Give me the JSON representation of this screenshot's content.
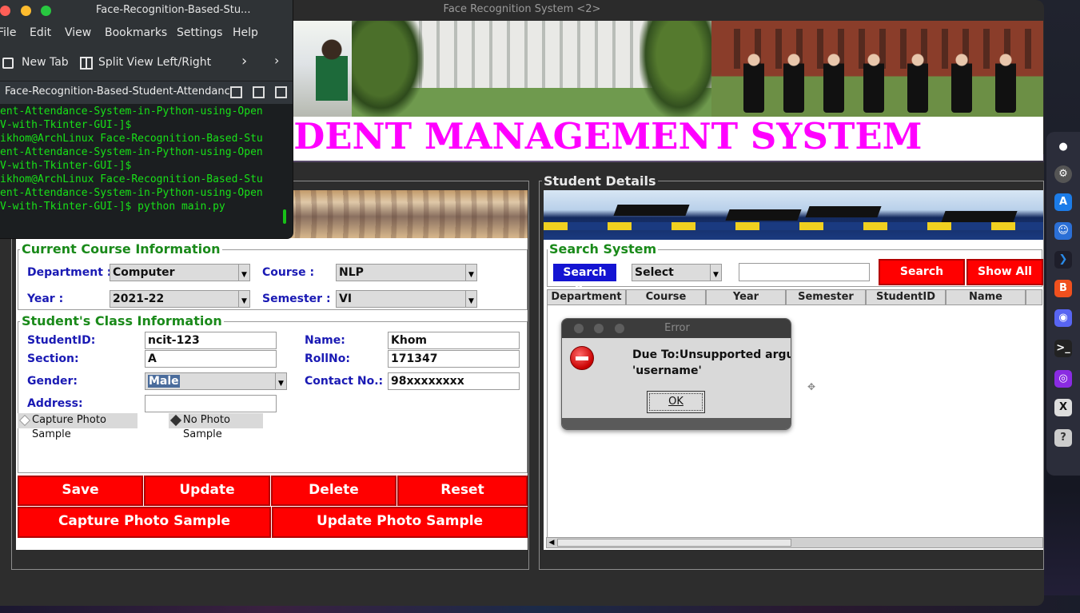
{
  "main_window": {
    "title": "Face Recognition System <2>",
    "app_title": "STUDENT MANAGEMENT SYSTEM"
  },
  "terminal": {
    "title": "Face-Recognition-Based-Stu...",
    "menu": [
      "File",
      "Edit",
      "View",
      "Bookmarks",
      "Settings",
      "Help"
    ],
    "toolbar": {
      "new_tab": "New Tab",
      "split_view": "Split View Left/Right"
    },
    "tab_label": "Face-Recognition-Based-Student-Attendance-",
    "lines": [
      "ent-Attendance-System-in-Python-using-Open",
      "V-with-Tkinter-GUI-]$",
      "ikhom@ArchLinux Face-Recognition-Based-Stu",
      "ent-Attendance-System-in-Python-using-Open",
      "V-with-Tkinter-GUI-]$",
      "ikhom@ArchLinux Face-Recognition-Based-Stu",
      "ent-Attendance-System-in-Python-using-Open",
      "V-with-Tkinter-GUI-]$ python main.py"
    ]
  },
  "course_info": {
    "title": "Current Course Information",
    "department_label": "Department :",
    "department_value": "Computer",
    "course_label": "Course :",
    "course_value": "NLP",
    "year_label": "Year :",
    "year_value": "2021-22",
    "semester_label": "Semester :",
    "semester_value": "VI"
  },
  "class_info": {
    "title": "Student's Class Information",
    "studentid_label": "StudentID:",
    "studentid_value": "ncit-123",
    "name_label": "Name:",
    "name_value": "Khom",
    "section_label": "Section:",
    "section_value": "A",
    "rollno_label": "RollNo:",
    "rollno_value": "171347",
    "gender_label": "Gender:",
    "gender_value": "Male",
    "contact_label": "Contact No.:",
    "contact_value": "98xxxxxxxx",
    "address_label": "Address:",
    "address_value": "",
    "radio_capture": "Capture Photo Sample",
    "radio_no_photo": "No Photo Sample"
  },
  "buttons": {
    "save": "Save",
    "update": "Update",
    "delete": "Delete",
    "reset": "Reset",
    "capture_photo": "Capture Photo Sample",
    "update_photo": "Update Photo Sample"
  },
  "student_details": {
    "title": "Student Details",
    "search_title": "Search System",
    "search_by_label": "Search By:",
    "search_select": "Select",
    "search_value": "",
    "search_button": "Search",
    "show_all_button": "Show All",
    "columns": [
      "Department",
      "Course",
      "Year",
      "Semester",
      "StudentID",
      "Name"
    ]
  },
  "error_dialog": {
    "title": "Error",
    "message_line1": "Due To:Unsupported argument",
    "message_line2": "'username'",
    "ok_label": "OK"
  },
  "colors": {
    "title_magenta": "#ff00ff",
    "button_red": "#ff0000",
    "label_blue": "#1a1ab4",
    "section_green": "#1a8a1a",
    "terminal_green": "#18e018"
  }
}
